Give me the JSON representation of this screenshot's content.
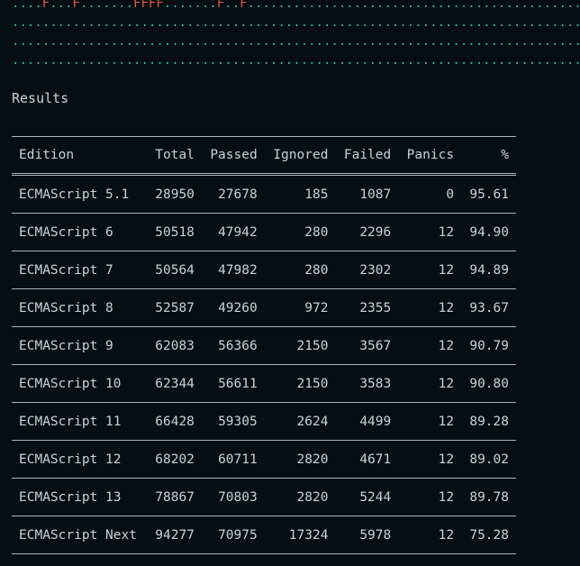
{
  "progress": {
    "lines": [
      "....F...F.......FFFF.......F..F...........................................................",
      "..........................................................................................",
      "..........................................................................................",
      ".........................................................................................."
    ],
    "colors": {
      "pass": "#1fbfa6",
      "fail": "#e2583b"
    }
  },
  "results": {
    "heading": "Results",
    "columns": [
      "Edition",
      "Total",
      "Passed",
      "Ignored",
      "Failed",
      "Panics",
      "%"
    ],
    "rows": [
      [
        "ECMAScript 5.1",
        "28950",
        "27678",
        "185",
        "1087",
        "0",
        "95.61"
      ],
      [
        "ECMAScript 6",
        "50518",
        "47942",
        "280",
        "2296",
        "12",
        "94.90"
      ],
      [
        "ECMAScript 7",
        "50564",
        "47982",
        "280",
        "2302",
        "12",
        "94.89"
      ],
      [
        "ECMAScript 8",
        "52587",
        "49260",
        "972",
        "2355",
        "12",
        "93.67"
      ],
      [
        "ECMAScript 9",
        "62083",
        "56366",
        "2150",
        "3567",
        "12",
        "90.79"
      ],
      [
        "ECMAScript 10",
        "62344",
        "56611",
        "2150",
        "3583",
        "12",
        "90.80"
      ],
      [
        "ECMAScript 11",
        "66428",
        "59305",
        "2624",
        "4499",
        "12",
        "89.28"
      ],
      [
        "ECMAScript 12",
        "68202",
        "60711",
        "2820",
        "4671",
        "12",
        "89.02"
      ],
      [
        "ECMAScript 13",
        "78867",
        "70803",
        "2820",
        "5244",
        "12",
        "89.78"
      ],
      [
        "ECMAScript Next",
        "94277",
        "70975",
        "17324",
        "5978",
        "12",
        "75.28"
      ]
    ]
  }
}
